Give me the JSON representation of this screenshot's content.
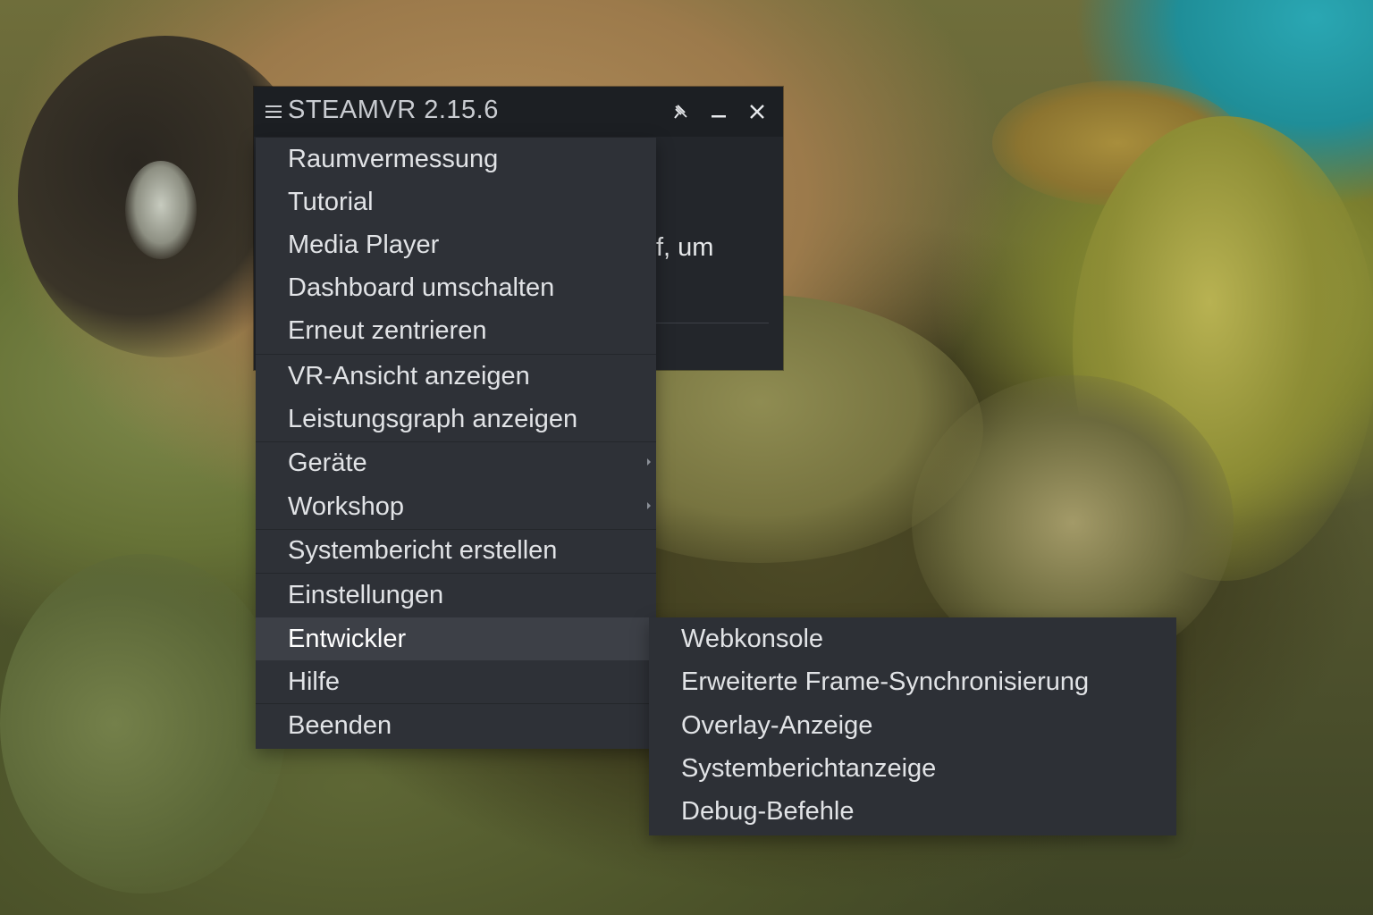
{
  "window": {
    "title": "STEAMVR 2.15.6",
    "partial_text": "f, um"
  },
  "main_menu": {
    "items": [
      {
        "label": "Raumvermessung"
      },
      {
        "label": "Tutorial"
      },
      {
        "label": "Media Player"
      },
      {
        "label": "Dashboard umschalten"
      },
      {
        "label": "Erneut zentrieren"
      },
      {
        "label": "VR-Ansicht anzeigen"
      },
      {
        "label": "Leistungsgraph anzeigen"
      },
      {
        "label": "Geräte"
      },
      {
        "label": "Workshop"
      },
      {
        "label": "Systembericht erstellen"
      },
      {
        "label": "Einstellungen"
      },
      {
        "label": "Entwickler"
      },
      {
        "label": "Hilfe"
      },
      {
        "label": "Beenden"
      }
    ]
  },
  "sub_menu": {
    "items": [
      {
        "label": "Webkonsole"
      },
      {
        "label": "Erweiterte Frame-Synchronisierung"
      },
      {
        "label": "Overlay-Anzeige"
      },
      {
        "label": "Systemberichtanzeige"
      },
      {
        "label": "Debug-Befehle"
      }
    ]
  },
  "colors": {
    "menu_bg": "#2e3137",
    "menu_active": "#3d4047",
    "titlebar": "#1c1f23",
    "text": "#e1e3e6"
  }
}
